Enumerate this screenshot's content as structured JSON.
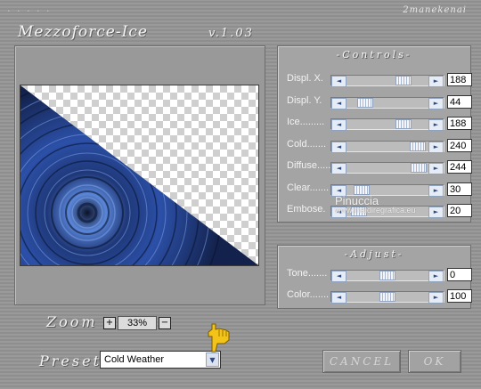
{
  "window": {
    "dots": "· · · · ·",
    "brand": "2manekenai",
    "title": "Mezzoforce-Ice",
    "version": "v.1.03"
  },
  "controls": {
    "title": "-Controls-",
    "sliders": [
      {
        "label": "Displ. X.",
        "value": "188",
        "level": 0.737
      },
      {
        "label": "Displ. Y.",
        "value": "44",
        "level": 0.173
      },
      {
        "label": "Ice.........",
        "value": "188",
        "level": 0.737
      },
      {
        "label": "Cold.......",
        "value": "240",
        "level": 0.941
      },
      {
        "label": "Diffuse.....",
        "value": "244",
        "level": 0.957
      },
      {
        "label": "Clear.......",
        "value": "30",
        "level": 0.118
      },
      {
        "label": "Embose.",
        "value": "20",
        "level": 0.078
      }
    ]
  },
  "adjust": {
    "title": "-Adjust-",
    "sliders": [
      {
        "label": "Tone.......",
        "value": "0",
        "level": 0.5
      },
      {
        "label": "Color.......",
        "value": "100",
        "level": 0.5
      }
    ]
  },
  "zoom": {
    "label": "Zoom",
    "plus": "+",
    "value": "33%",
    "minus": "−"
  },
  "preset": {
    "label": "Preset",
    "selected": "Cold Weather"
  },
  "buttons": {
    "cancel": "CANCEL",
    "ok": "OK"
  },
  "watermark": {
    "line1": "Pinuccia",
    "line2": "www.maidiregrafica.eu"
  },
  "colors": {
    "accent": "#2e4a80",
    "preview_blue": "#2a4da0",
    "cursor": "#f2c318"
  },
  "icons": {
    "left_arrow": "◄",
    "right_arrow": "►",
    "dropdown": "▼"
  }
}
